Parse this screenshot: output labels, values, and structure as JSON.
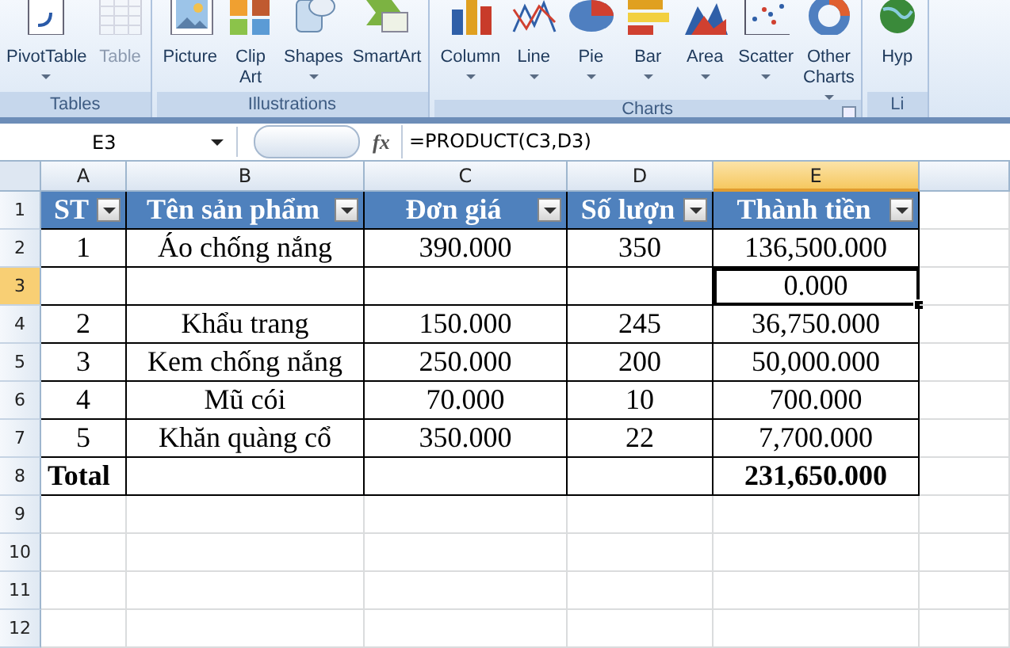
{
  "ribbon": {
    "groups": [
      {
        "label": "Tables",
        "launcher": false,
        "buttons": [
          {
            "label": "PivotTable",
            "dropdown": true,
            "disabled": false
          },
          {
            "label": "Table",
            "dropdown": false,
            "disabled": true
          }
        ]
      },
      {
        "label": "Illustrations",
        "launcher": false,
        "buttons": [
          {
            "label": "Picture",
            "dropdown": false,
            "disabled": false
          },
          {
            "label": "Clip Art",
            "dropdown": false,
            "disabled": false
          },
          {
            "label": "Shapes",
            "dropdown": true,
            "disabled": false
          },
          {
            "label": "SmartArt",
            "dropdown": false,
            "disabled": false
          }
        ]
      },
      {
        "label": "Charts",
        "launcher": true,
        "buttons": [
          {
            "label": "Column",
            "dropdown": true,
            "disabled": false
          },
          {
            "label": "Line",
            "dropdown": true,
            "disabled": false
          },
          {
            "label": "Pie",
            "dropdown": true,
            "disabled": false
          },
          {
            "label": "Bar",
            "dropdown": true,
            "disabled": false
          },
          {
            "label": "Area",
            "dropdown": true,
            "disabled": false
          },
          {
            "label": "Scatter",
            "dropdown": true,
            "disabled": false
          },
          {
            "label": "Other Charts",
            "dropdown": true,
            "disabled": false
          }
        ]
      },
      {
        "label": "Li",
        "launcher": false,
        "buttons": [
          {
            "label": "Hyp",
            "dropdown": false,
            "disabled": false
          }
        ]
      }
    ]
  },
  "formula_bar": {
    "name_box": "E3",
    "fx": "fx",
    "formula": "=PRODUCT(C3,D3)"
  },
  "sheet": {
    "columns": [
      {
        "label": "A",
        "selected": false
      },
      {
        "label": "B",
        "selected": false
      },
      {
        "label": "C",
        "selected": false
      },
      {
        "label": "D",
        "selected": false
      },
      {
        "label": "E",
        "selected": true
      }
    ],
    "rows": [
      {
        "number": "1",
        "selected": false,
        "kind": "header",
        "cells": [
          {
            "text": "ST",
            "selected": false
          },
          {
            "text": "Tên sản phẩm",
            "selected": false
          },
          {
            "text": "Đơn giá",
            "selected": false
          },
          {
            "text": "Số lượn",
            "selected": false
          },
          {
            "text": "Thành tiền",
            "selected": false
          }
        ]
      },
      {
        "number": "2",
        "selected": false,
        "kind": "data",
        "cells": [
          {
            "text": "1",
            "selected": false
          },
          {
            "text": "Áo chống nắng",
            "selected": false
          },
          {
            "text": "390.000",
            "selected": false
          },
          {
            "text": "350",
            "selected": false
          },
          {
            "text": "136,500.000",
            "selected": false
          }
        ]
      },
      {
        "number": "3",
        "selected": true,
        "kind": "data",
        "cells": [
          {
            "selected": false
          },
          {
            "selected": false
          },
          {
            "selected": false
          },
          {
            "selected": false
          },
          {
            "text": "0.000",
            "selected": true
          }
        ]
      },
      {
        "number": "4",
        "selected": false,
        "kind": "data",
        "cells": [
          {
            "text": "2",
            "selected": false
          },
          {
            "text": "Khẩu trang",
            "selected": false
          },
          {
            "text": "150.000",
            "selected": false
          },
          {
            "text": "245",
            "selected": false
          },
          {
            "text": "36,750.000",
            "selected": false
          }
        ]
      },
      {
        "number": "5",
        "selected": false,
        "kind": "data",
        "cells": [
          {
            "text": "3",
            "selected": false
          },
          {
            "text": "Kem chống nắng",
            "selected": false
          },
          {
            "text": "250.000",
            "selected": false
          },
          {
            "text": "200",
            "selected": false
          },
          {
            "text": "50,000.000",
            "selected": false
          }
        ]
      },
      {
        "number": "6",
        "selected": false,
        "kind": "data",
        "cells": [
          {
            "text": "4",
            "selected": false
          },
          {
            "text": "Mũ cói",
            "selected": false
          },
          {
            "text": "70.000",
            "selected": false
          },
          {
            "text": "10",
            "selected": false
          },
          {
            "text": "700.000",
            "selected": false
          }
        ]
      },
      {
        "number": "7",
        "selected": false,
        "kind": "data",
        "cells": [
          {
            "text": "5",
            "selected": false
          },
          {
            "text": "Khăn quàng cổ",
            "selected": false
          },
          {
            "text": "350.000",
            "selected": false
          },
          {
            "text": "22",
            "selected": false
          },
          {
            "text": "7,700.000",
            "selected": false
          }
        ]
      },
      {
        "number": "8",
        "selected": false,
        "kind": "total",
        "cells": [
          {
            "text": "Total",
            "selected": false
          },
          {
            "selected": false
          },
          {
            "selected": false
          },
          {
            "selected": false
          },
          {
            "text": "231,650.000",
            "selected": false
          }
        ]
      },
      {
        "number": "9",
        "selected": false,
        "kind": "empty"
      },
      {
        "number": "10",
        "selected": false,
        "kind": "empty"
      },
      {
        "number": "11",
        "selected": false,
        "kind": "empty"
      },
      {
        "number": "12",
        "selected": false,
        "kind": "empty"
      }
    ]
  }
}
